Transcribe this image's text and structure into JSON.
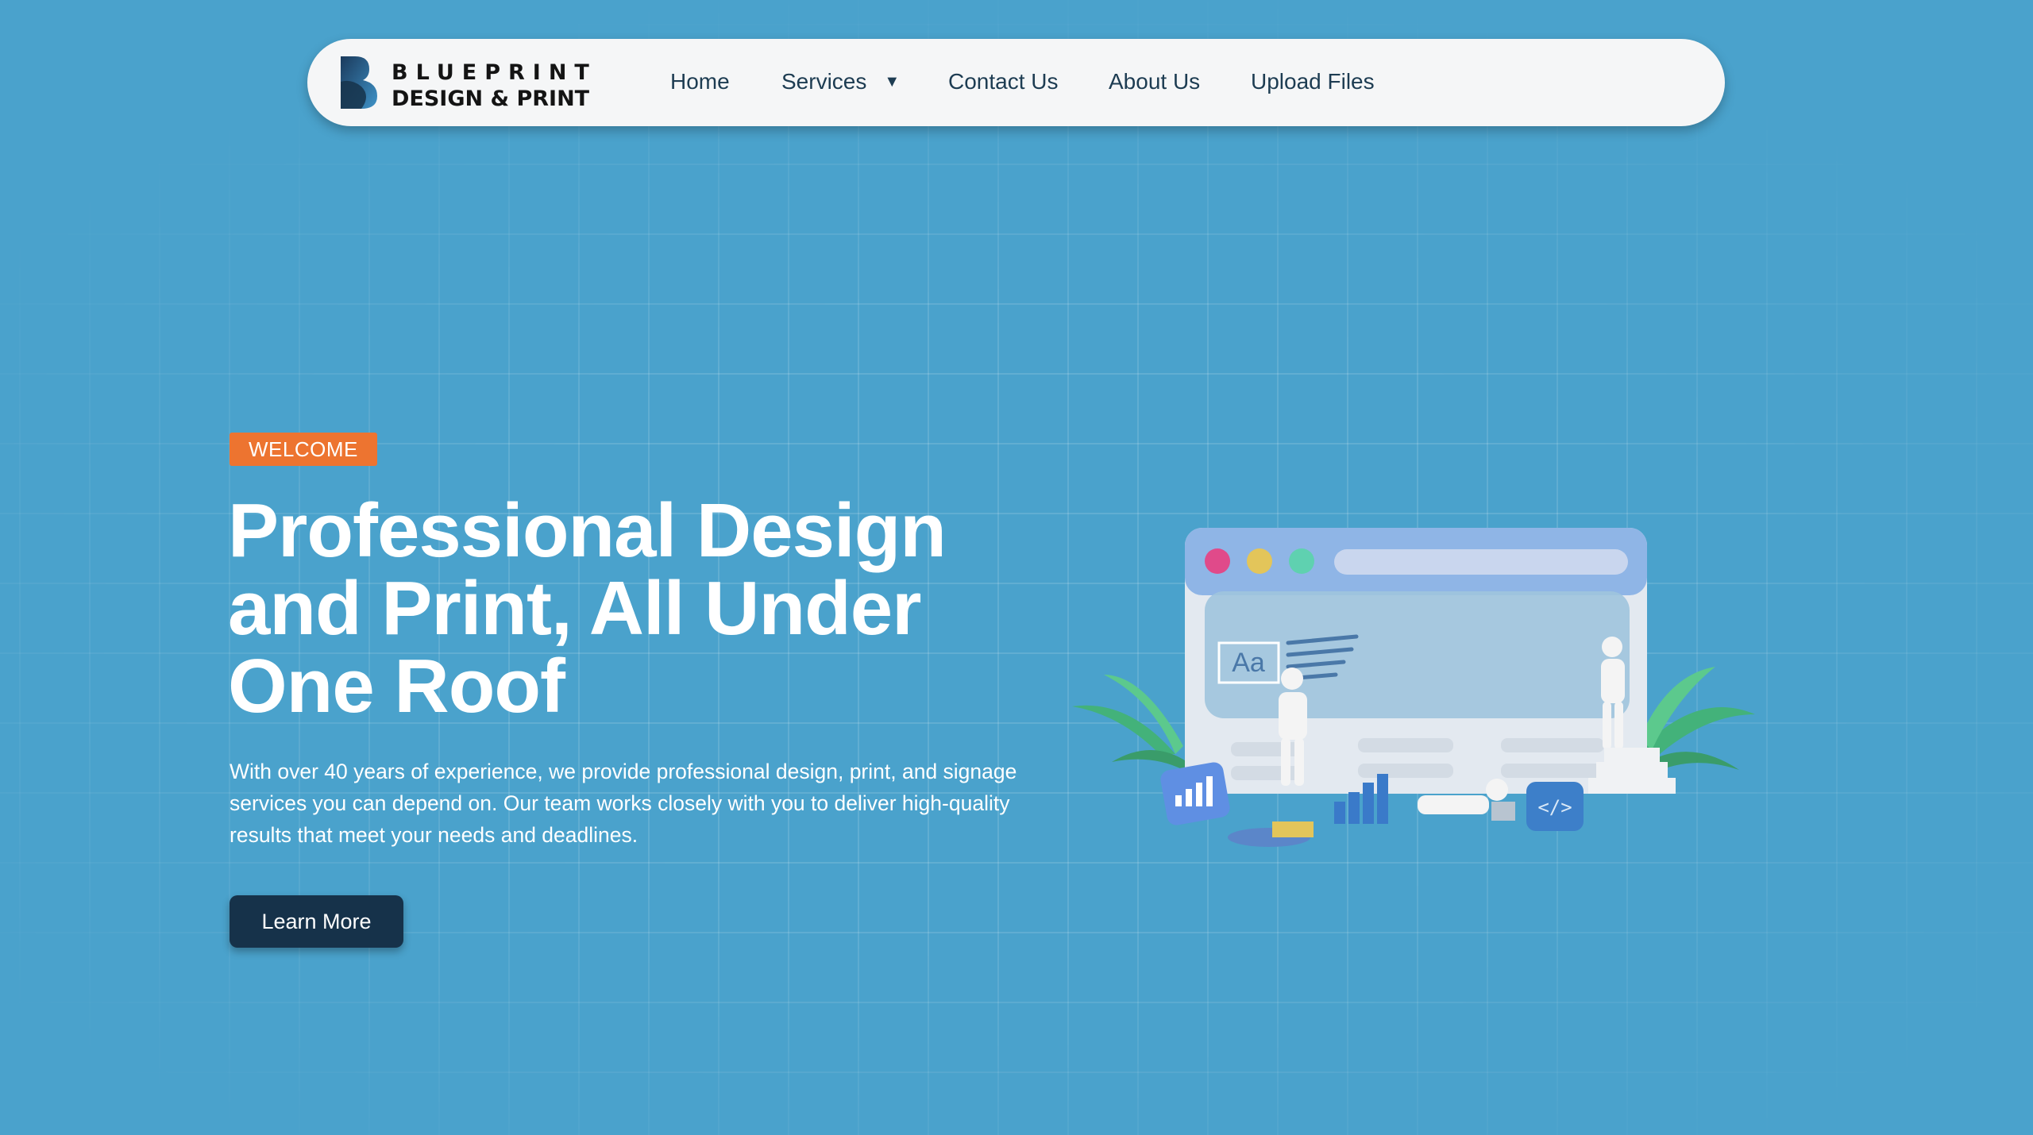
{
  "brand": {
    "line1": "BLUEPRINT",
    "line2": "DESIGN & PRINT",
    "color_dark": "#141414",
    "mark_colors": [
      "#1b3a5c",
      "#3f93c8"
    ]
  },
  "nav": {
    "items": [
      {
        "label": "Home"
      },
      {
        "label": "Services",
        "icon": "caret-down-icon"
      },
      {
        "label": "Contact Us"
      },
      {
        "label": "About Us"
      },
      {
        "label": "Upload Files"
      }
    ]
  },
  "hero": {
    "badge": "WELCOME",
    "headline": "Professional Design and Print, All Under One Roof",
    "description": "With over 40 years of experience, we provide professional design, print, and signage services you can depend on. Our team works closely with you to deliver high-quality results that meet your needs and deadlines.",
    "cta_label": "Learn More"
  },
  "illustration": {
    "text_sample": "Aa",
    "code_tag": "</>",
    "window_dot_colors": [
      "#e04a8a",
      "#e3c55a",
      "#5fd1b0"
    ]
  },
  "colors": {
    "background": "#4aa2cc",
    "accent": "#ed7430",
    "button": "#16324a",
    "nav_text": "#1d3c52"
  }
}
